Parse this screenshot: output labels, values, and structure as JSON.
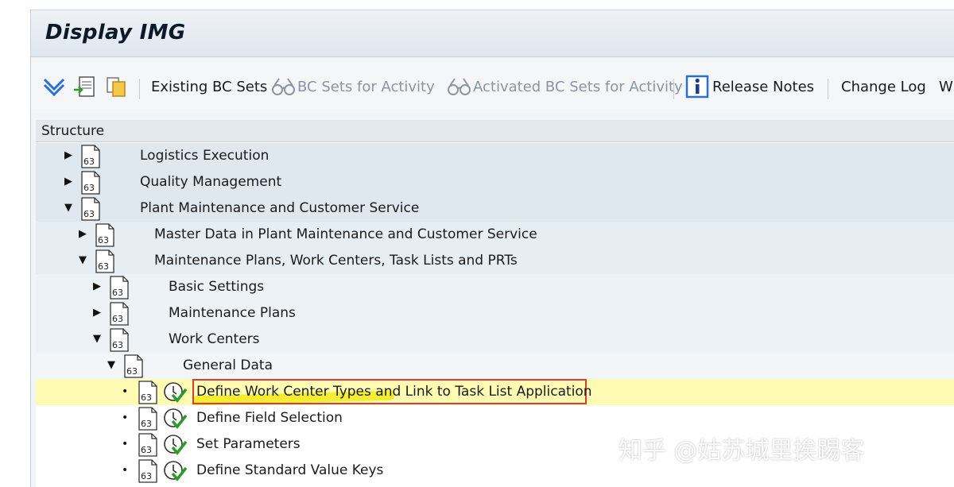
{
  "window": {
    "title": "Display IMG"
  },
  "toolbar": {
    "existing_bc_sets": "Existing BC Sets",
    "bc_sets_for_activity": "BC Sets for Activity",
    "activated_bc_sets_for_activity": "Activated BC Sets for Activity",
    "release_notes": "Release Notes",
    "change_log": "Change Log",
    "where_used": "Wh"
  },
  "structure": {
    "header": "Structure",
    "rows": [
      {
        "label": "Logistics Execution",
        "state": "collapsed"
      },
      {
        "label": "Quality Management",
        "state": "collapsed"
      },
      {
        "label": "Plant Maintenance and Customer Service",
        "state": "expanded"
      },
      {
        "label": "Master Data in Plant Maintenance and Customer Service",
        "state": "collapsed"
      },
      {
        "label": "Maintenance Plans, Work Centers, Task Lists and PRTs",
        "state": "expanded"
      },
      {
        "label": "Basic Settings",
        "state": "collapsed"
      },
      {
        "label": "Maintenance Plans",
        "state": "collapsed"
      },
      {
        "label": "Work Centers",
        "state": "expanded"
      },
      {
        "label": "General Data",
        "state": "expanded"
      },
      {
        "label": "Define Work Center Types and Link to Task List Application",
        "state": "leaf",
        "selected": true
      },
      {
        "label": "Define Field Selection",
        "state": "leaf"
      },
      {
        "label": "Set Parameters",
        "state": "leaf"
      },
      {
        "label": "Define Standard Value Keys",
        "state": "leaf"
      }
    ]
  },
  "watermark": "知乎 @姑苏城里挨踢客",
  "colors": {
    "highlight": "#fffbb3",
    "selection_border": "#d93a3a",
    "marker": "#f3ea1a",
    "accent": "#2a6fd6"
  }
}
